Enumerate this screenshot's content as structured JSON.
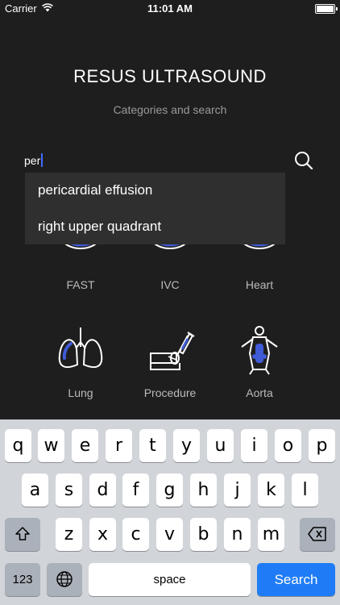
{
  "status_bar": {
    "carrier": "Carrier",
    "time": "11:01 AM"
  },
  "header": {
    "title": "RESUS ULTRASOUND",
    "subtitle": "Categories and search"
  },
  "search": {
    "value": "per"
  },
  "suggestions": [
    "pericardial effusion",
    "right upper quadrant"
  ],
  "categories": [
    {
      "label": "FAST",
      "icon": "fast-probe-icon"
    },
    {
      "label": "IVC",
      "icon": "ivc-probe-icon"
    },
    {
      "label": "Heart",
      "icon": "heart-probe-icon"
    },
    {
      "label": "Lung",
      "icon": "lung-icon"
    },
    {
      "label": "Procedure",
      "icon": "procedure-syringe-icon"
    },
    {
      "label": "Aorta",
      "icon": "aorta-body-icon"
    }
  ],
  "colors": {
    "accent": "#3f5bd6",
    "background": "#1e1e1e",
    "search_key": "#1f7cf6"
  },
  "keyboard": {
    "row1": [
      "q",
      "w",
      "e",
      "r",
      "t",
      "y",
      "u",
      "i",
      "o",
      "p"
    ],
    "row2": [
      "a",
      "s",
      "d",
      "f",
      "g",
      "h",
      "j",
      "k",
      "l"
    ],
    "row3": [
      "z",
      "x",
      "c",
      "v",
      "b",
      "n",
      "m"
    ],
    "numbers_label": "123",
    "space_label": "space",
    "search_label": "Search"
  }
}
